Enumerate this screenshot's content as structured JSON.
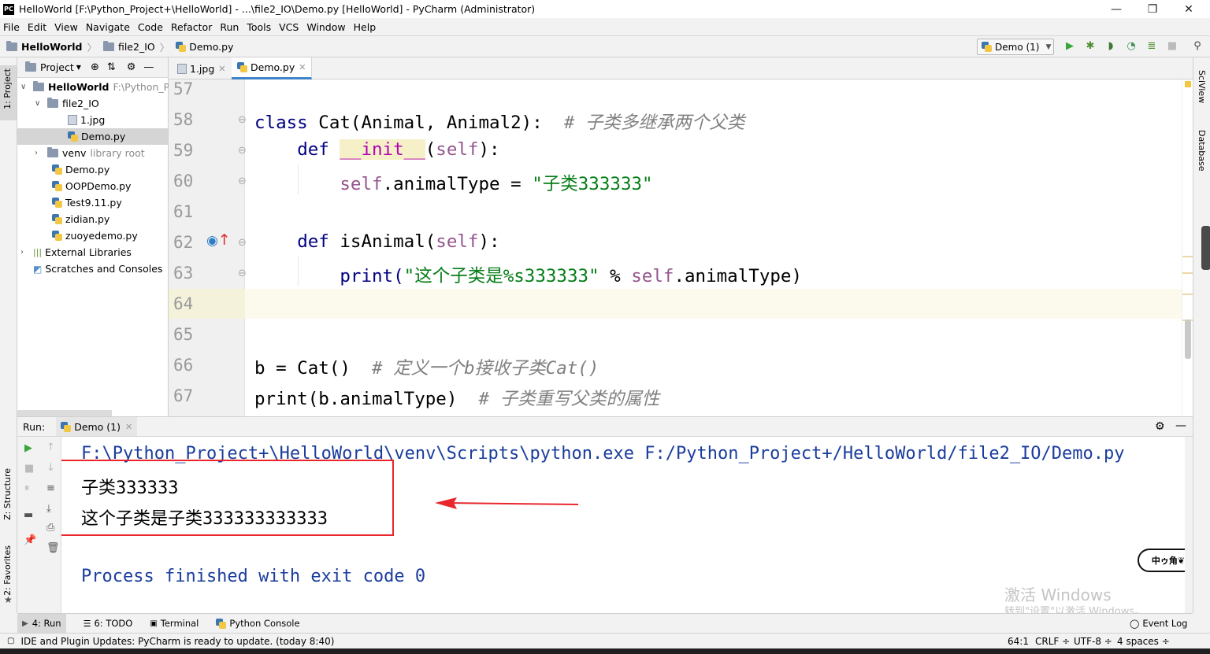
{
  "window": {
    "title": "HelloWorld [F:\\Python_Project+\\HelloWorld] - ...\\file2_IO\\Demo.py [HelloWorld] - PyCharm (Administrator)",
    "minimize": "—",
    "maximize": "❐",
    "close": "✕"
  },
  "menu": [
    "File",
    "Edit",
    "View",
    "Navigate",
    "Code",
    "Refactor",
    "Run",
    "Tools",
    "VCS",
    "Window",
    "Help"
  ],
  "breadcrumbs": [
    "HelloWorld",
    "file2_IO",
    "Demo.py"
  ],
  "run_config": {
    "label": "Demo (1)"
  },
  "left_tabs": {
    "project": "1: Project",
    "structure": "Z: Structure",
    "favorites": "2: Favorites"
  },
  "right_tabs": {
    "sciview": "SciView",
    "database": "Database"
  },
  "project_panel": {
    "title": "Project",
    "tree": [
      {
        "label": "HelloWorld",
        "hint": "F:\\Python_Pro",
        "kind": "folder"
      },
      {
        "label": "file2_IO",
        "hint": "",
        "kind": "folder"
      },
      {
        "label": "1.jpg",
        "hint": "",
        "kind": "image"
      },
      {
        "label": "Demo.py",
        "hint": "",
        "kind": "py"
      },
      {
        "label": "venv",
        "hint": "library root",
        "kind": "folder"
      },
      {
        "label": "Demo.py",
        "hint": "",
        "kind": "py"
      },
      {
        "label": "OOPDemo.py",
        "hint": "",
        "kind": "py"
      },
      {
        "label": "Test9.11.py",
        "hint": "",
        "kind": "py"
      },
      {
        "label": "zidian.py",
        "hint": "",
        "kind": "py"
      },
      {
        "label": "zuoyedemo.py",
        "hint": "",
        "kind": "py"
      },
      {
        "label": "External Libraries",
        "hint": "",
        "kind": "lib"
      },
      {
        "label": "Scratches and Consoles",
        "hint": "",
        "kind": "scratch"
      }
    ]
  },
  "editor_tabs": [
    {
      "label": "1.jpg",
      "active": false
    },
    {
      "label": "Demo.py",
      "active": true
    }
  ],
  "code": {
    "line_numbers": [
      "57",
      "58",
      "59",
      "60",
      "61",
      "62",
      "63",
      "64",
      "65",
      "66",
      "67"
    ],
    "l58_kw": "class",
    "l58_a": " Cat(Animal, Animal2):  ",
    "l58_cmt": "# 子类多继承两个父类",
    "l59_kw": "def",
    "l59_fn": "__init__",
    "l59_self": "self",
    "l59_end": "):",
    "l60_self": "self",
    "l60_a": ".animalType = ",
    "l60_str": "\"子类333333\"",
    "l62_kw": "def",
    "l62_a": " isAnimal(",
    "l62_self": "self",
    "l62_end": "):",
    "l63_a": "print(",
    "l63_str": "\"这个子类是%s333333\"",
    "l63_b": " % ",
    "l63_self": "self",
    "l63_end": ".animalType)",
    "l66_a": "b = Cat()  ",
    "l66_cmt": "# 定义一个b接收子类Cat()",
    "l67_a": "print(b.animalType)  ",
    "l67_cmt": "# 子类重写父类的属性"
  },
  "run_panel": {
    "label": "Run:",
    "tab": "Demo (1)",
    "console": [
      "F:\\Python_Project+\\HelloWorld\\venv\\Scripts\\python.exe F:/Python_Project+/HelloWorld/file2_IO/Demo.py",
      "子类333333",
      "这个子类是子类333333333333",
      "Process finished with exit code 0"
    ]
  },
  "bottom_tabs": [
    "4: Run",
    "6: TODO",
    "Terminal",
    "Python Console"
  ],
  "event_log": "Event Log",
  "status": {
    "message": "IDE and Plugin Updates: PyCharm is ready to update. (today 8:40)",
    "position": "64:1",
    "line_sep": "CRLF ÷",
    "encoding": "UTF-8 ÷",
    "indent": "4 spaces ÷"
  },
  "watermark": {
    "line1": "激活 Windows",
    "line2": "转到\"设置\"以激活 Windows。"
  },
  "badge": "中ゥ角❦",
  "colors": {
    "annotation_red": "#e8262c",
    "console_blue": "#1a3d9c",
    "keyword": "#000080",
    "string": "#067d17"
  }
}
